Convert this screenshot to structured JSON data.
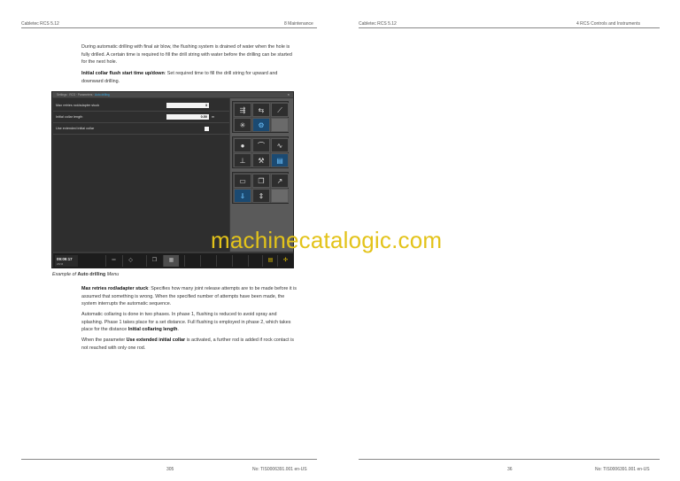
{
  "header": {
    "left_title": "Cabletec RCS 5.12",
    "left_section": "8 Maintenance",
    "right_title": "Cabletec RCS 5.12",
    "right_section": "4 RCS Controls and Instruments"
  },
  "intro": {
    "p1": "During automatic drilling with final air blow, the flushing system is drained of water when the hole is fully drilled. A certain time is required to fill the drill string with water before the drilling can be started for the next hole.",
    "p2_bold": "Initial collar flush start time up/down",
    "p2_rest": ": Set required time to fill the drill string for upward and downward drilling."
  },
  "screen": {
    "breadcrumb": "Settings · RCS · Parameters · ",
    "breadcrumb_current": "Auto drilling",
    "close": "×",
    "rows": [
      {
        "label": "Max retries rod/adapter stuck",
        "value": "3",
        "unit": ""
      },
      {
        "label": "Initial collar length",
        "value": "0.50",
        "unit": "m"
      },
      {
        "label": "Use extended initial collar",
        "value": "",
        "unit": ""
      }
    ],
    "clock_time": "09:09:17",
    "clock_date": "2/6/16",
    "icons": {
      "g1": [
        "drill-icon",
        "rod-icon",
        "boom-icon",
        "flush-icon",
        "settings-icon",
        ""
      ],
      "g2": [
        "dome-icon",
        "level-icon",
        "graph-icon",
        "collar-icon",
        "wrench-icon",
        "pages-icon"
      ],
      "g3": [
        "feed-icon",
        "copy-icon",
        "arm-icon",
        "auto-drill-icon",
        "adjust-icon",
        ""
      ]
    }
  },
  "caption": {
    "prefix": "Example of ",
    "bold": "Auto drilling",
    "suffix": " Menu"
  },
  "body": {
    "p3_bold": "Max retries rod/adapter stuck",
    "p3_rest": ": Specifies how many joint release attempts are to be made before it is assumed that something is wrong. When the specified number of attempts have been made, the system interrupts the automatic sequence.",
    "p4": "Automatic collaring is done in two phases. In phase 1, flushing is reduced to avoid spray and splashing. Phase 1 takes place for a set distance. Full flushing is employed in phase 2, which takes place for the distance ",
    "p4_bold": "Initial collaring length",
    "p4_end": ".",
    "p5_pre": "When the parameter ",
    "p5_bold": "Use extended initial collar",
    "p5_rest": " is activated, a further rod is added if rock contact is not reached with only one rod."
  },
  "watermark": "machinecatalogic.com",
  "footer": {
    "left_page": "305",
    "left_doc": "No: TIS0006391.001 en-US",
    "right_page": "36",
    "right_doc": "No: TIS0006391.001 en-US"
  },
  "colors": {
    "watermark": "#e3c31a",
    "accent_blue": "#39a8e0",
    "screen_bg": "#3a3a3a"
  }
}
